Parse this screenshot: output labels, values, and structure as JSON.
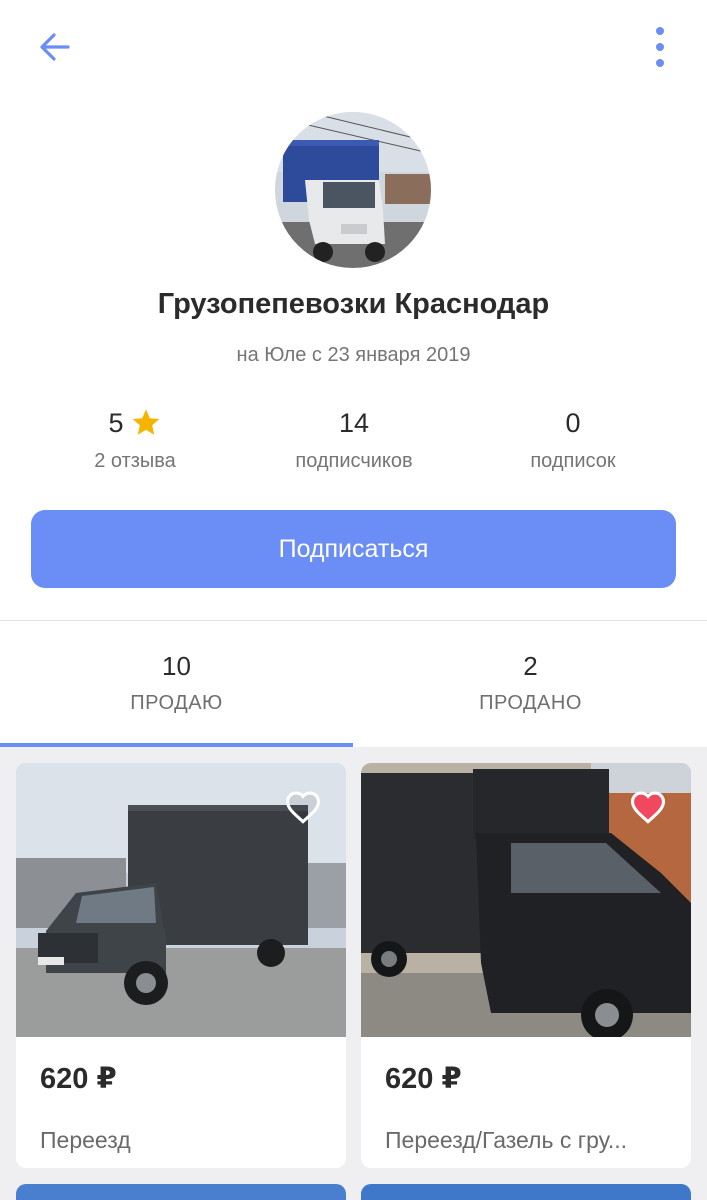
{
  "header": {
    "back_icon": "arrow-left-icon",
    "menu_icon": "more-vertical-icon",
    "accent_color": "#6a8ef6"
  },
  "profile": {
    "name": "Грузопепевозки Краснодар",
    "since": "на Юле с 23 января 2019"
  },
  "stats": {
    "rating": {
      "value": "5",
      "label": "2 отзыва",
      "icon": "star-icon",
      "star_color": "#f5b400"
    },
    "followers": {
      "value": "14",
      "label": "подписчиков"
    },
    "following": {
      "value": "0",
      "label": "подписок"
    }
  },
  "subscribe_label": "Подписаться",
  "tabs": [
    {
      "count": "10",
      "label": "ПРОДАЮ",
      "active": true
    },
    {
      "count": "2",
      "label": "ПРОДАНО",
      "active": false
    }
  ],
  "listings": [
    {
      "price": "620 ₽",
      "title": "Переезд",
      "favorited": false,
      "favorite_icon": "heart-outline-icon"
    },
    {
      "price": "620 ₽",
      "title": "Переезд/Газель с гру...",
      "favorited": true,
      "favorite_icon": "heart-filled-icon",
      "favorite_color": "#f0485f"
    }
  ]
}
